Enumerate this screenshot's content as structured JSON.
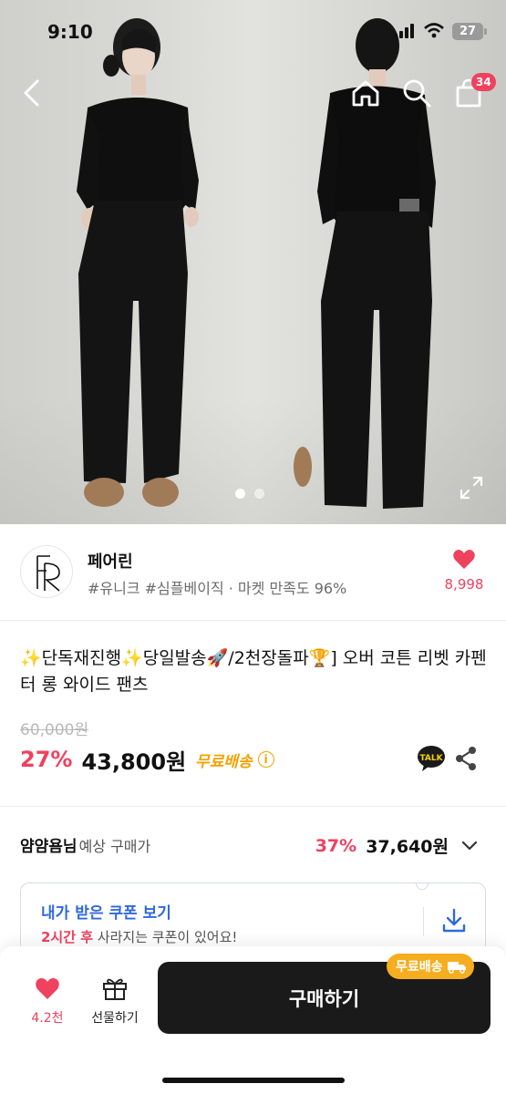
{
  "status_bar": {
    "time": "9:10",
    "battery": "27"
  },
  "nav": {
    "cart_count": "34"
  },
  "gallery": {
    "total_images": 2,
    "active_index": 0
  },
  "store": {
    "name": "페어린",
    "tags": "#유니크 #심플베이직 · 마켓 만족도 96%",
    "like_count": "8,998"
  },
  "product": {
    "title": "✨단독재진행✨당일발송🚀/2천장돌파🏆] 오버 코튼 리벳 카펜터 롱 와이드 팬츠",
    "original_price": "60,000원",
    "discount": "27%",
    "price": "43,800원",
    "free_shipping": "무료배송",
    "info_icon_char": "i"
  },
  "expected_price": {
    "user": "얌얌욤님",
    "label": "예상 구매가",
    "discount": "37%",
    "price": "37,640원"
  },
  "coupon": {
    "title": "내가 받은 쿠폰 보기",
    "highlight": "2시간 후",
    "subtitle": " 사라지는 쿠폰이 있어요!"
  },
  "bottom_bar": {
    "like_count": "4.2천",
    "gift_label": "선물하기",
    "buy_label": "구매하기",
    "buy_badge": "무료배송"
  },
  "colors": {
    "accent_pink": "#f0415f",
    "free_shipping_yellow": "#f2a300",
    "coupon_blue": "#2f6ad9",
    "buy_button": "#1a1a1a"
  }
}
